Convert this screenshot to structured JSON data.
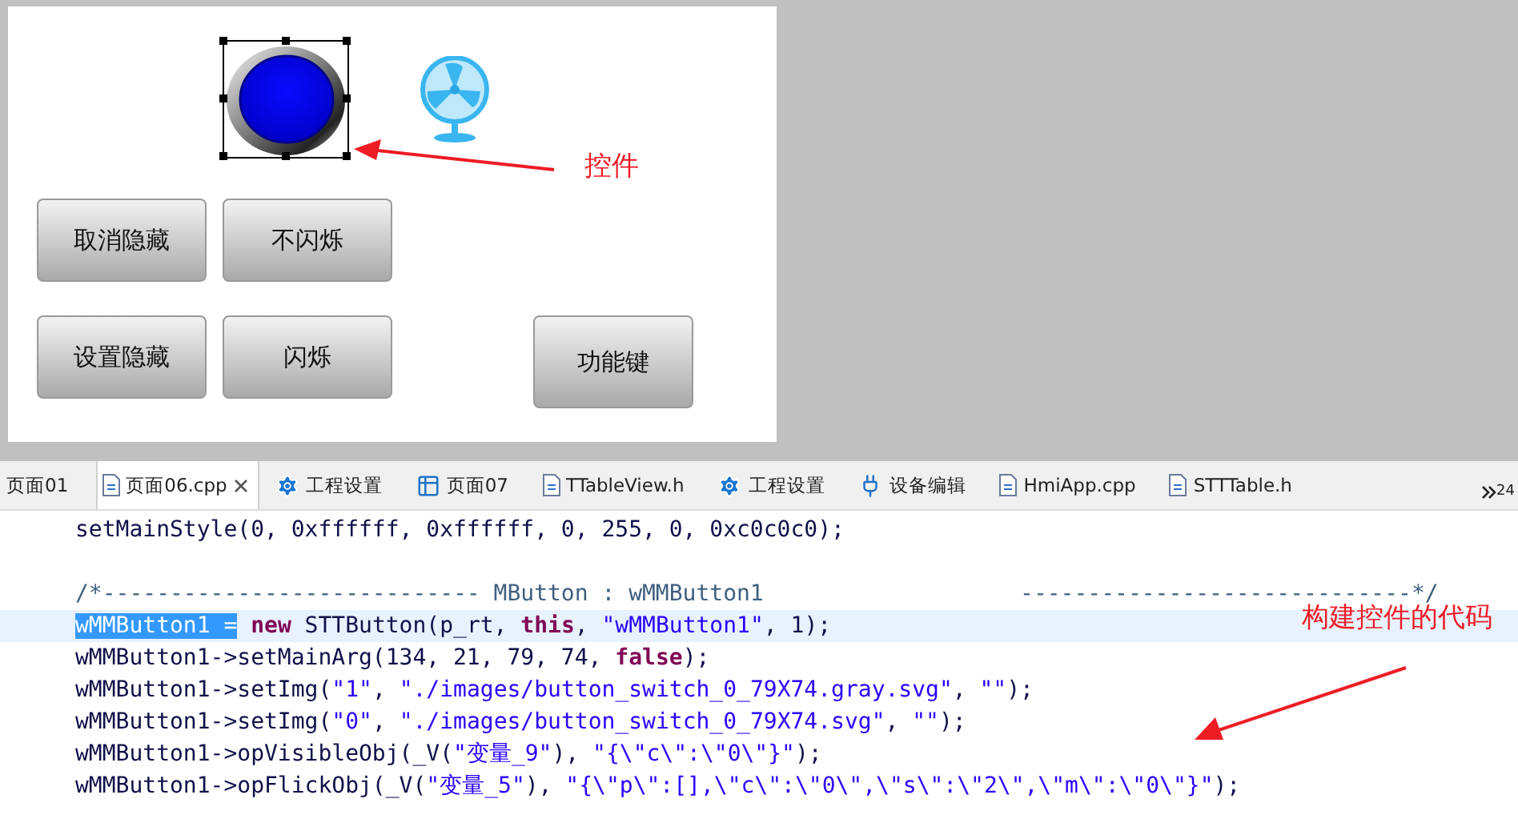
{
  "canvas": {
    "buttons": [
      {
        "label": "取消隐藏"
      },
      {
        "label": "不闪烁"
      },
      {
        "label": "设置隐藏"
      },
      {
        "label": "闪烁"
      },
      {
        "label": "功能键"
      }
    ],
    "selected_control": true
  },
  "annotations": [
    {
      "text": "控件"
    },
    {
      "text": "构建控件的代码"
    }
  ],
  "tabs": [
    {
      "label": "页面01",
      "kind": "page",
      "selected": false
    },
    {
      "label": "页面06.cpp",
      "kind": "source",
      "selected": true
    },
    {
      "label": "工程设置",
      "kind": "settings",
      "selected": false
    },
    {
      "label": "页面07",
      "kind": "table",
      "selected": false
    },
    {
      "label": "TTableView.h",
      "kind": "header",
      "selected": false
    },
    {
      "label": "工程设置",
      "kind": "settings",
      "selected": false
    },
    {
      "label": "设备编辑",
      "kind": "device",
      "selected": false
    },
    {
      "label": "HmiApp.cpp",
      "kind": "source",
      "selected": false
    },
    {
      "label": "STTTable.h",
      "kind": "header",
      "selected": false
    }
  ],
  "tab_overflow": {
    "count": "24"
  },
  "code_lines": [
    {
      "kind": "code",
      "current": false,
      "segments": [
        {
          "kind": "plain",
          "text": "setMainStyle(0, 0xffffff, 0xffffff, 0, 255, 0, 0xc0c0c0);"
        }
      ]
    },
    {
      "kind": "blank",
      "current": false
    },
    {
      "kind": "code",
      "current": false,
      "segments": [
        {
          "kind": "comment",
          "text": "/*---------------------------- MButton : wMMButton1                   -----------------------------*/"
        }
      ]
    },
    {
      "kind": "code",
      "current": true,
      "segments": [
        {
          "kind": "selected",
          "text": "wMMButton1 ="
        },
        {
          "kind": "keyword",
          "text": " new"
        },
        {
          "kind": "plain",
          "text": " STTButton(p_rt, "
        },
        {
          "kind": "keyword",
          "text": "this"
        },
        {
          "kind": "plain",
          "text": ", "
        },
        {
          "kind": "string",
          "text": "\"wMMButton1\""
        },
        {
          "kind": "plain",
          "text": ", 1);"
        }
      ]
    },
    {
      "kind": "code",
      "current": false,
      "segments": [
        {
          "kind": "plain",
          "text": "wMMButton1->setMainArg(134, 21, 79, 74, "
        },
        {
          "kind": "keyword",
          "text": "false"
        },
        {
          "kind": "plain",
          "text": ");"
        }
      ]
    },
    {
      "kind": "code",
      "current": false,
      "segments": [
        {
          "kind": "plain",
          "text": "wMMButton1->setImg("
        },
        {
          "kind": "string",
          "text": "\"1\""
        },
        {
          "kind": "plain",
          "text": ", "
        },
        {
          "kind": "string",
          "text": "\"./images/button_switch_0_79X74.gray.svg\""
        },
        {
          "kind": "plain",
          "text": ", "
        },
        {
          "kind": "string",
          "text": "\"\""
        },
        {
          "kind": "plain",
          "text": ");"
        }
      ]
    },
    {
      "kind": "code",
      "current": false,
      "segments": [
        {
          "kind": "plain",
          "text": "wMMButton1->setImg("
        },
        {
          "kind": "string",
          "text": "\"0\""
        },
        {
          "kind": "plain",
          "text": ", "
        },
        {
          "kind": "string",
          "text": "\"./images/button_switch_0_79X74.svg\""
        },
        {
          "kind": "plain",
          "text": ", "
        },
        {
          "kind": "string",
          "text": "\"\""
        },
        {
          "kind": "plain",
          "text": ");"
        }
      ]
    },
    {
      "kind": "code",
      "current": false,
      "segments": [
        {
          "kind": "plain",
          "text": "wMMButton1->opVisibleObj(_V("
        },
        {
          "kind": "string",
          "text": "\"变量_9\""
        },
        {
          "kind": "plain",
          "text": "), "
        },
        {
          "kind": "string",
          "text": "\"{\\\"c\\\":\\\"0\\\"}\""
        },
        {
          "kind": "plain",
          "text": ");"
        }
      ]
    },
    {
      "kind": "code",
      "current": false,
      "segments": [
        {
          "kind": "plain",
          "text": "wMMButton1->opFlickObj(_V("
        },
        {
          "kind": "string",
          "text": "\"变量_5\""
        },
        {
          "kind": "plain",
          "text": "), "
        },
        {
          "kind": "string",
          "text": "\"{\\\"p\\\":[],\\\"c\\\":\\\"0\\\",\\\"s\\\":\\\"2\\\",\\\"m\\\":\\\"0\\\"}\""
        },
        {
          "kind": "plain",
          "text": ");"
        }
      ]
    }
  ]
}
